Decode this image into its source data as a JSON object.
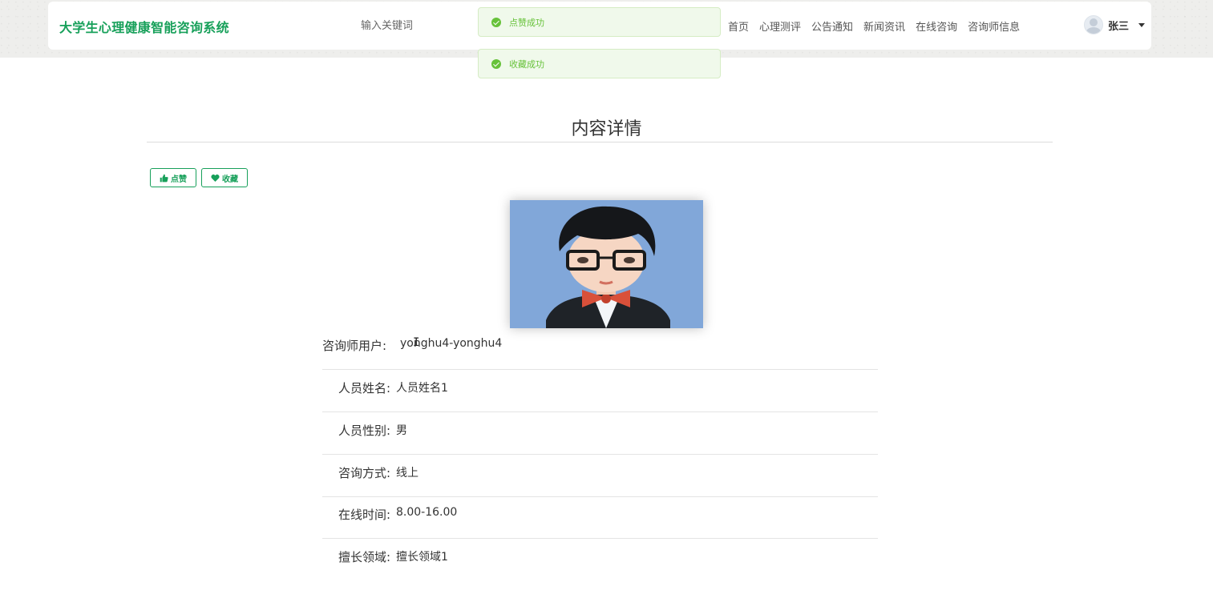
{
  "header": {
    "brand": "大学生心理健康智能咨询系统",
    "search_placeholder": "输入关键词",
    "nav": [
      "首页",
      "心理测评",
      "公告通知",
      "新闻资讯",
      "在线咨询",
      "咨询师信息"
    ],
    "user_name": "张三"
  },
  "toasts": [
    "点赞成功",
    "收藏成功"
  ],
  "page_title": "内容详情",
  "actions": {
    "like": "点赞",
    "favorite": "收藏"
  },
  "details": [
    {
      "label": "咨询师用户:",
      "value": "yonghu4-yonghu4"
    },
    {
      "label": "人员姓名:",
      "value": "人员姓名1"
    },
    {
      "label": "人员性别:",
      "value": "男"
    },
    {
      "label": "咨询方式:",
      "value": "线上"
    },
    {
      "label": "在线时间:",
      "value": "8.00-16.00"
    },
    {
      "label": "擅长领域:",
      "value": "擅长领域1"
    }
  ],
  "colors": {
    "brand": "#17a05a",
    "toast_bg": "#f0f9eb",
    "toast_text": "#67c23a"
  },
  "icons": [
    "check-circle-icon",
    "thumbs-up-icon",
    "heart-icon",
    "user-avatar-icon",
    "caret-down-icon"
  ]
}
